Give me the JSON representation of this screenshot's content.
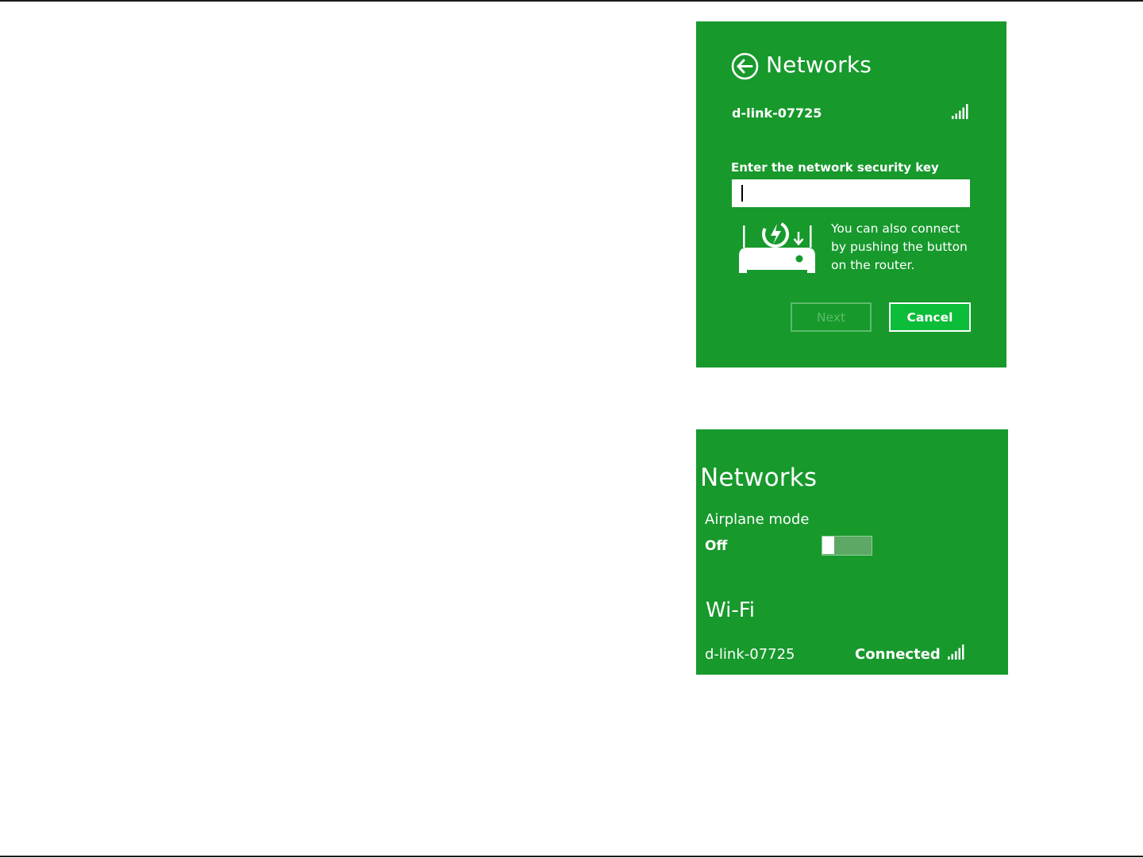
{
  "connect_panel": {
    "title": "Networks",
    "network_name": "d-link-07725",
    "security_key_label": "Enter the network security key",
    "security_key_value": "",
    "wps_message_line1": "You can also connect",
    "wps_message_line2": "by pushing the button",
    "wps_message_line3": "on the router.",
    "next_label": "Next",
    "cancel_label": "Cancel"
  },
  "status_panel": {
    "title": "Networks",
    "airplane_mode_label": "Airplane mode",
    "airplane_mode_value": "Off",
    "wifi_title": "Wi-Fi",
    "network_name": "d-link-07725",
    "network_status": "Connected"
  },
  "colors": {
    "panel_green": "#17992c",
    "cancel_fill": "#0bbd39",
    "disabled_text": "#5cbc6a"
  },
  "icons": {
    "back": "back-arrow-circle-icon",
    "signal": "wifi-signal-bars-icon",
    "router": "wps-router-icon"
  }
}
